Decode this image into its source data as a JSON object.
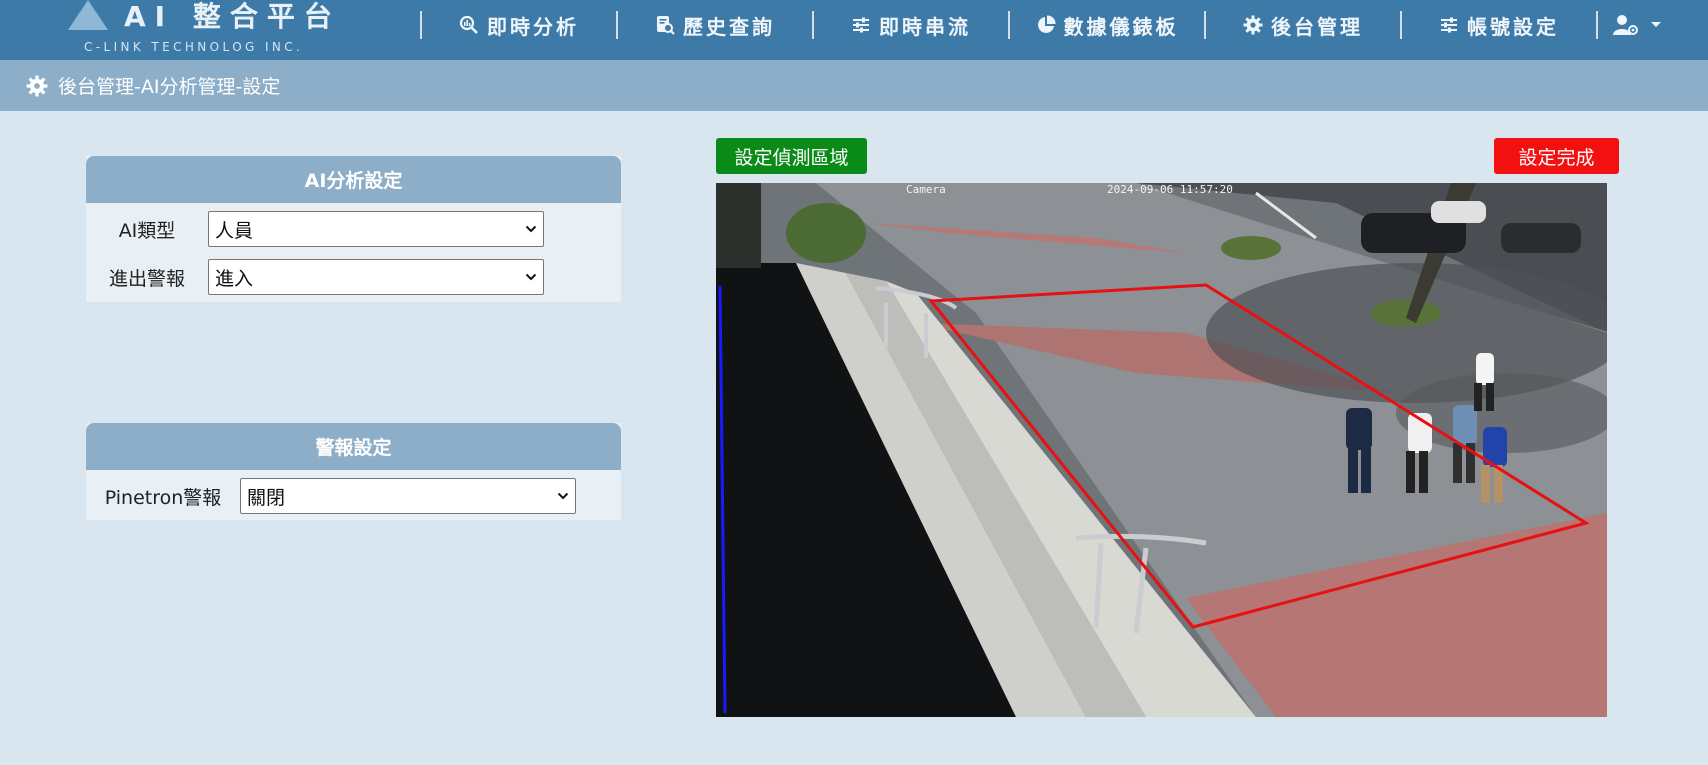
{
  "app": {
    "title": "AI 整合平台",
    "subtitle": "C-LINK TECHNOLOG INC."
  },
  "nav": [
    {
      "label": "即時分析",
      "icon": "analytics-search-icon"
    },
    {
      "label": "歷史查詢",
      "icon": "document-search-icon"
    },
    {
      "label": "即時串流",
      "icon": "sliders-icon"
    },
    {
      "label": "數據儀錶板",
      "icon": "pie-chart-icon"
    },
    {
      "label": "後台管理",
      "icon": "gear-icon"
    },
    {
      "label": "帳號設定",
      "icon": "sliders-icon"
    }
  ],
  "user_menu": {
    "icon": "user-settings-icon",
    "caret": "caret-down-icon"
  },
  "breadcrumb": {
    "icon": "gear-icon",
    "text": "後台管理-AI分析管理-設定"
  },
  "ai_settings": {
    "title": "AI分析設定",
    "ai_type_label": "AI類型",
    "ai_type_value": "人員",
    "alert_dir_label": "進出警報",
    "alert_dir_value": "進入"
  },
  "alert_settings": {
    "title": "警報設定",
    "pinetron_label": "Pinetron警報",
    "pinetron_value": "關閉"
  },
  "actions": {
    "set_area_label": "設定偵測區域",
    "done_label": "設定完成"
  },
  "camera": {
    "osd_name": "Camera",
    "osd_time": "2024-09-06 11:57:20",
    "zone_color": "#e81010",
    "line_color": "#1a1aff"
  },
  "colors": {
    "header": "#3e7aa8",
    "subheader": "#8caec8",
    "background": "#d9e6ef",
    "green_button": "#0a8a16",
    "red_button": "#f31010"
  }
}
